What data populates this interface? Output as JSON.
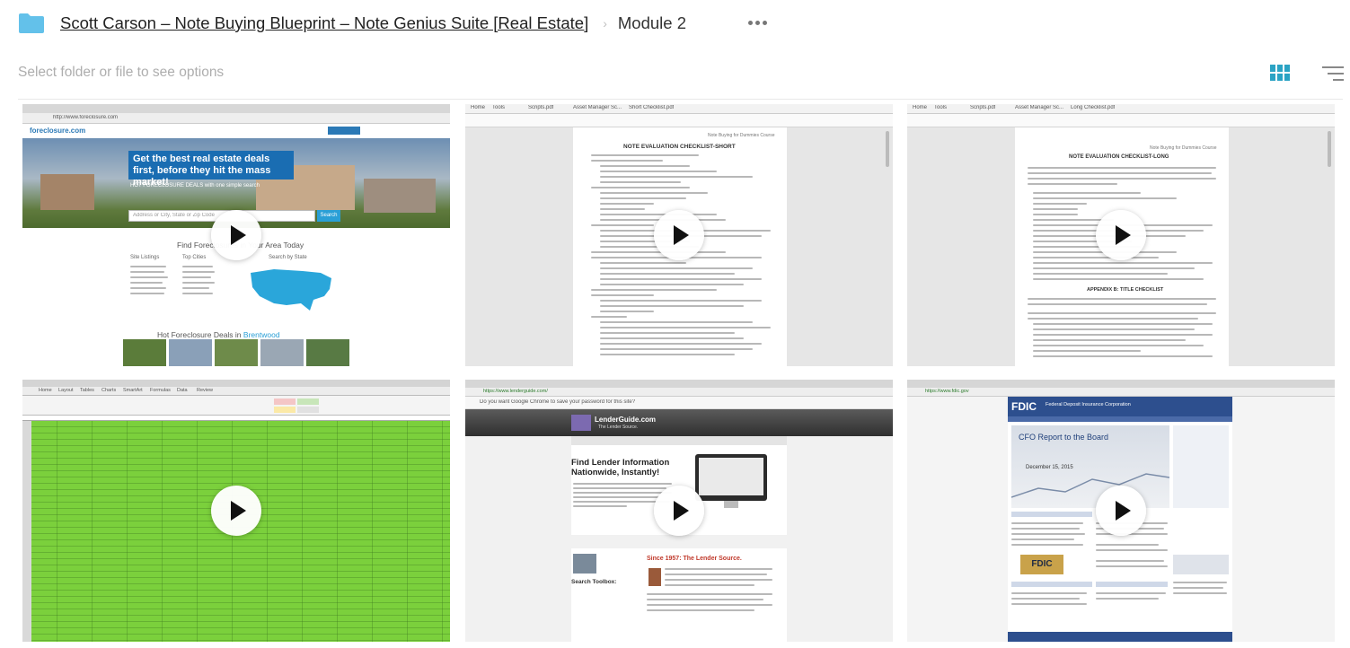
{
  "breadcrumb": {
    "root": "Scott Carson – Note Buying Blueprint – Note Genius Suite [Real Estate]",
    "separator": "›",
    "current": "Module 2"
  },
  "toolbar": {
    "hint": "Select folder or file to see options",
    "view_icon": "grid-view-icon",
    "sort_icon": "sort-icon"
  },
  "colors": {
    "accent": "#2ba3c4",
    "folder": "#63c1ea",
    "spreadsheet_green": "#7bd03c",
    "fdic_blue": "#2d4f8e"
  },
  "videos": [
    {
      "id": "v1",
      "kind": "website",
      "url": "http://www.foreclosure.com",
      "brand": "foreclosure.com",
      "headline": "Get the best real estate deals first, before they hit the mass market!",
      "subline": "HOT FORECLOSURE DEALS with one simple search",
      "search_placeholder": "Address or City, State or Zip Code",
      "search_button": "Search",
      "section_title": "Find Foreclosures in Your Area Today",
      "col1": "Site Listings",
      "col2": "Top Cities",
      "col3": "Search by State",
      "hot_title": "Hot Foreclosure Deals in",
      "hot_city": "Brentwood"
    },
    {
      "id": "v2",
      "kind": "pdf",
      "tabs": [
        "Home",
        "Tools",
        "Scripts.pdf",
        "Asset Manager Sc...",
        "Short Checklist.pdf"
      ],
      "header_note": "Note Buying for Dummies Course",
      "doc_title": "NOTE EVALUATION CHECKLIST-SHORT"
    },
    {
      "id": "v3",
      "kind": "pdf",
      "tabs": [
        "Home",
        "Tools",
        "Scripts.pdf",
        "Asset Manager Sc...",
        "Long Checklist.pdf"
      ],
      "header_note": "Note Buying for Dummies Course",
      "doc_title": "NOTE EVALUATION CHECKLIST-LONG",
      "appendix_title": "APPENDIX B: TITLE CHECKLIST"
    },
    {
      "id": "v4",
      "kind": "spreadsheet",
      "ribbon_tabs": [
        "Home",
        "Layout",
        "Tables",
        "Charts",
        "SmartArt",
        "Formulas",
        "Data",
        "Review"
      ]
    },
    {
      "id": "v5",
      "kind": "website",
      "url": "https://www.lenderguide.com/",
      "chrome_prompt": "Do you want Google Chrome to save your password for this site?",
      "brand": "LenderGuide.com",
      "brand_sub": "The Lender Source.",
      "headline": "Find Lender Information Nationwide, Instantly!",
      "since": "Since 1957: The Lender Source.",
      "toolbox": "Search Toolbox:"
    },
    {
      "id": "v6",
      "kind": "website",
      "url": "https://www.fdic.gov",
      "brand": "FDIC",
      "org": "Federal Deposit Insurance Corporation",
      "headline": "CFO Report to the Board",
      "date": "December 15, 2015",
      "seal": "FDIC"
    }
  ]
}
